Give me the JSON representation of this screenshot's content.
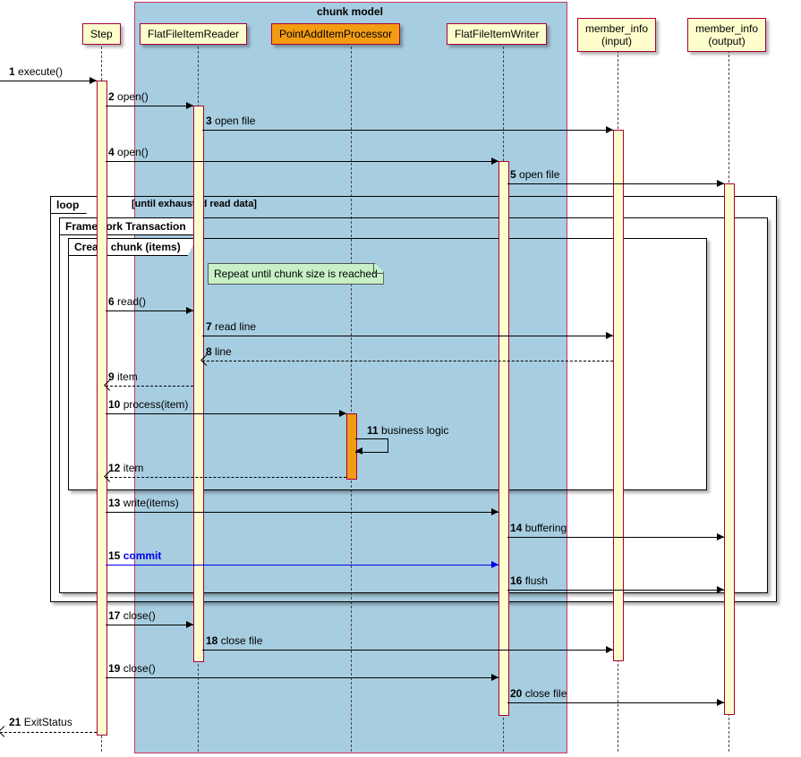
{
  "box": {
    "title": "chunk model"
  },
  "participants": {
    "step": "Step",
    "reader": "FlatFileItemReader",
    "processor": "PointAddItemProcessor",
    "writer": "FlatFileItemWriter",
    "input": "member_info\n(input)",
    "output": "member_info\n(output)"
  },
  "frames": {
    "loop": {
      "label": "loop",
      "cond": "[until exhausted read data]"
    },
    "tx": {
      "label": "Framework Transaction"
    },
    "chunk": {
      "label": "Create chunk (items)"
    }
  },
  "note": "Repeat until chunk size is reached",
  "messages": {
    "m1": {
      "n": "1",
      "t": "execute()"
    },
    "m2": {
      "n": "2",
      "t": "open()"
    },
    "m3": {
      "n": "3",
      "t": "open file"
    },
    "m4": {
      "n": "4",
      "t": "open()"
    },
    "m5": {
      "n": "5",
      "t": "open file"
    },
    "m6": {
      "n": "6",
      "t": "read()"
    },
    "m7": {
      "n": "7",
      "t": "read line"
    },
    "m8": {
      "n": "8",
      "t": "line"
    },
    "m9": {
      "n": "9",
      "t": "item"
    },
    "m10": {
      "n": "10",
      "t": "process(item)"
    },
    "m11": {
      "n": "11",
      "t": "business logic"
    },
    "m12": {
      "n": "12",
      "t": "item"
    },
    "m13": {
      "n": "13",
      "t": "write(items)"
    },
    "m14": {
      "n": "14",
      "t": "buffering"
    },
    "m15": {
      "n": "15",
      "t": "commit"
    },
    "m16": {
      "n": "16",
      "t": "flush"
    },
    "m17": {
      "n": "17",
      "t": "close()"
    },
    "m18": {
      "n": "18",
      "t": "close file"
    },
    "m19": {
      "n": "19",
      "t": "close()"
    },
    "m20": {
      "n": "20",
      "t": "close file"
    },
    "m21": {
      "n": "21",
      "t": "ExitStatus"
    }
  },
  "chart_data": {
    "type": "sequence-diagram",
    "box": {
      "name": "chunk model",
      "participants": [
        "FlatFileItemReader",
        "PointAddItemProcessor",
        "FlatFileItemWriter"
      ]
    },
    "participants": [
      "Step",
      "FlatFileItemReader",
      "PointAddItemProcessor",
      "FlatFileItemWriter",
      "member_info (input)",
      "member_info (output)"
    ],
    "messages": [
      {
        "n": 1,
        "from": "(external)",
        "to": "Step",
        "label": "execute()",
        "style": "solid"
      },
      {
        "n": 2,
        "from": "Step",
        "to": "FlatFileItemReader",
        "label": "open()",
        "style": "solid"
      },
      {
        "n": 3,
        "from": "FlatFileItemReader",
        "to": "member_info (input)",
        "label": "open file",
        "style": "solid"
      },
      {
        "n": 4,
        "from": "Step",
        "to": "FlatFileItemWriter",
        "label": "open()",
        "style": "solid"
      },
      {
        "n": 5,
        "from": "FlatFileItemWriter",
        "to": "member_info (output)",
        "label": "open file",
        "style": "solid"
      },
      {
        "n": 6,
        "from": "Step",
        "to": "FlatFileItemReader",
        "label": "read()",
        "style": "solid",
        "frame": "Create chunk (items)"
      },
      {
        "n": 7,
        "from": "FlatFileItemReader",
        "to": "member_info (input)",
        "label": "read line",
        "style": "solid"
      },
      {
        "n": 8,
        "from": "member_info (input)",
        "to": "FlatFileItemReader",
        "label": "line",
        "style": "dashed-return"
      },
      {
        "n": 9,
        "from": "FlatFileItemReader",
        "to": "Step",
        "label": "item",
        "style": "dashed-return"
      },
      {
        "n": 10,
        "from": "Step",
        "to": "PointAddItemProcessor",
        "label": "process(item)",
        "style": "solid"
      },
      {
        "n": 11,
        "from": "PointAddItemProcessor",
        "to": "PointAddItemProcessor",
        "label": "business logic",
        "style": "self"
      },
      {
        "n": 12,
        "from": "PointAddItemProcessor",
        "to": "Step",
        "label": "item",
        "style": "dashed-return"
      },
      {
        "n": 13,
        "from": "Step",
        "to": "FlatFileItemWriter",
        "label": "write(items)",
        "style": "solid",
        "frame": "Framework Transaction"
      },
      {
        "n": 14,
        "from": "FlatFileItemWriter",
        "to": "member_info (output)",
        "label": "buffering",
        "style": "solid"
      },
      {
        "n": 15,
        "from": "Step",
        "to": "FlatFileItemWriter",
        "label": "commit",
        "style": "solid",
        "color": "blue"
      },
      {
        "n": 16,
        "from": "FlatFileItemWriter",
        "to": "member_info (output)",
        "label": "flush",
        "style": "solid"
      },
      {
        "n": 17,
        "from": "Step",
        "to": "FlatFileItemReader",
        "label": "close()",
        "style": "solid"
      },
      {
        "n": 18,
        "from": "FlatFileItemReader",
        "to": "member_info (input)",
        "label": "close file",
        "style": "solid"
      },
      {
        "n": 19,
        "from": "Step",
        "to": "FlatFileItemWriter",
        "label": "close()",
        "style": "solid"
      },
      {
        "n": 20,
        "from": "FlatFileItemWriter",
        "to": "member_info (output)",
        "label": "close file",
        "style": "solid"
      },
      {
        "n": 21,
        "from": "Step",
        "to": "(external)",
        "label": "ExitStatus",
        "style": "dashed-return"
      }
    ],
    "frames": [
      {
        "name": "loop",
        "condition": "[until exhausted read data]",
        "contains": [
          6,
          7,
          8,
          9,
          10,
          11,
          12,
          13,
          14,
          15,
          16
        ]
      },
      {
        "name": "Framework Transaction",
        "contains": [
          6,
          7,
          8,
          9,
          10,
          11,
          12,
          13,
          14,
          15,
          16
        ]
      },
      {
        "name": "Create chunk (items)",
        "contains": [
          6,
          7,
          8,
          9,
          10,
          11,
          12
        ],
        "note": "Repeat until chunk size is reached"
      }
    ]
  }
}
